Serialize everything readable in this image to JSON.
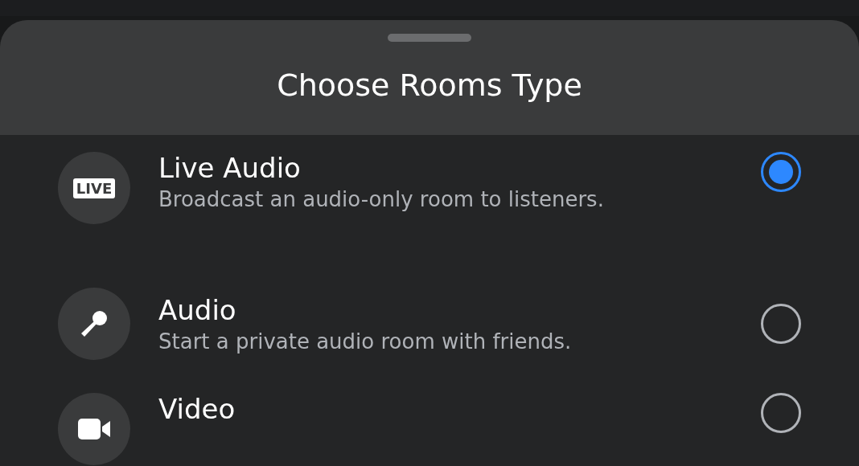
{
  "sheet": {
    "title": "Choose Rooms Type"
  },
  "options": [
    {
      "kind": "live",
      "title": "Live Audio",
      "subtitle": "Broadcast an audio-only room to listeners.",
      "selected": true,
      "badge": "LIVE"
    },
    {
      "kind": "mic",
      "title": "Audio",
      "subtitle": "Start a private audio room with friends.",
      "selected": false
    },
    {
      "kind": "video",
      "title": "Video",
      "selected": false
    }
  ]
}
